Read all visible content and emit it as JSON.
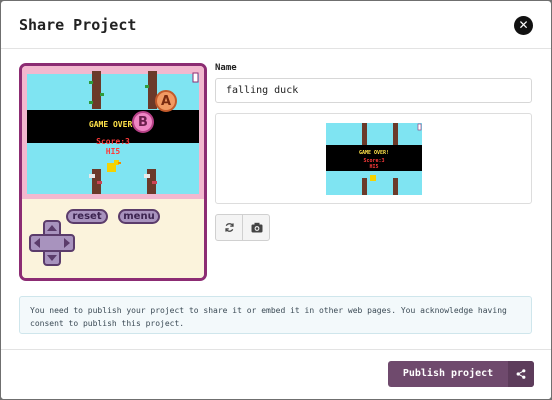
{
  "dialog": {
    "title": "Share Project",
    "close_icon": "close-icon"
  },
  "simulator": {
    "game_over_text": "GAME OVER!",
    "score_text": "Score:3",
    "hi_text": "HI5",
    "reset_label": "reset",
    "menu_label": "menu",
    "a_label": "A",
    "b_label": "B",
    "colors": {
      "frame": "#8c2c73",
      "screen_bg": "#7fe4f2",
      "banner": "#000000",
      "body": "#fbf3dc"
    }
  },
  "form": {
    "name_label": "Name",
    "name_value": "falling duck"
  },
  "toolbar": {
    "refresh_icon": "refresh-icon",
    "screenshot_icon": "camera-icon"
  },
  "notice": {
    "text": "You need to publish your project to share it or embed it in other web pages. You acknowledge having consent to publish this project."
  },
  "footer": {
    "publish_label": "Publish project",
    "share_icon": "share-icon",
    "accent": "#6f4a6d"
  }
}
